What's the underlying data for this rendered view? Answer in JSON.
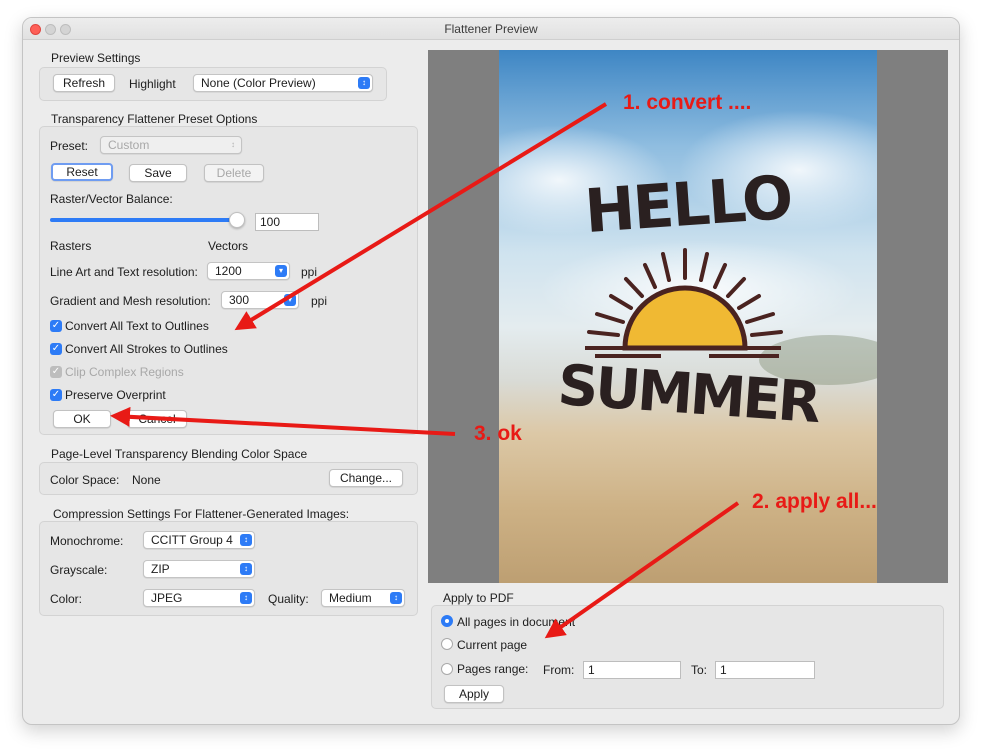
{
  "window": {
    "title": "Flattener Preview"
  },
  "preview_settings": {
    "title": "Preview Settings",
    "refresh": "Refresh",
    "highlight_label": "Highlight",
    "highlight_value": "None (Color Preview)"
  },
  "preset_options": {
    "title": "Transparency Flattener Preset Options",
    "preset_label": "Preset:",
    "preset_value": "Custom",
    "reset": "Reset",
    "save": "Save",
    "delete": "Delete",
    "balance_label": "Raster/Vector Balance:",
    "balance_value": "100",
    "balance_fraction": 1.0,
    "rasters": "Rasters",
    "vectors": "Vectors",
    "line_art_label": "Line Art and Text resolution:",
    "line_art_value": "1200",
    "gradient_label": "Gradient and Mesh resolution:",
    "gradient_value": "300",
    "unit": "ppi",
    "options": [
      {
        "label": "Convert All Text to Outlines",
        "checked": true,
        "disabled": false
      },
      {
        "label": "Convert All Strokes to Outlines",
        "checked": true,
        "disabled": false
      },
      {
        "label": "Clip Complex Regions",
        "checked": true,
        "disabled": true
      },
      {
        "label": "Preserve Overprint",
        "checked": true,
        "disabled": false
      }
    ],
    "ok": "OK",
    "cancel": "Cancel"
  },
  "blending": {
    "title": "Page-Level Transparency Blending Color Space",
    "color_space_label": "Color Space:",
    "color_space_value": "None",
    "change": "Change..."
  },
  "compression": {
    "title": "Compression Settings For Flattener-Generated Images:",
    "monochrome_label": "Monochrome:",
    "monochrome_value": "CCITT Group 4",
    "grayscale_label": "Grayscale:",
    "grayscale_value": "ZIP",
    "color_label": "Color:",
    "color_value": "JPEG",
    "quality_label": "Quality:",
    "quality_value": "Medium"
  },
  "preview": {
    "hello": "HELLO",
    "summer": "SUMMER"
  },
  "apply_pdf": {
    "title": "Apply to PDF",
    "all_pages": "All pages in document",
    "current_page": "Current page",
    "pages_range": "Pages range:",
    "from_label": "From:",
    "from_value": "1",
    "to_label": "To:",
    "to_value": "1",
    "apply": "Apply"
  },
  "annotations": {
    "a1": "1. convert ....",
    "a2": "2. apply all...",
    "a3": "3. ok"
  },
  "colors": {
    "accent": "#2d7bf6",
    "annotation": "#e81a16"
  }
}
